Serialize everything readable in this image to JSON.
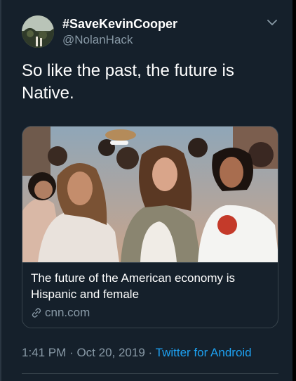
{
  "tweet": {
    "display_name": "#SaveKevinCooper",
    "handle": "@NolanHack",
    "text": "So like the past, the future is Native.",
    "time": "1:41 PM",
    "separator": "·",
    "date": "Oct 20, 2019",
    "source": "Twitter for Android"
  },
  "card": {
    "title": "The future of the American economy is Hispanic and female",
    "domain": "cnn.com"
  },
  "icons": {
    "caret": "chevron-down-icon",
    "link": "link-icon"
  },
  "colors": {
    "background": "#15202b",
    "primary_text": "#ffffff",
    "secondary_text": "#8899a6",
    "accent": "#1da1f2",
    "border": "#38444d"
  }
}
